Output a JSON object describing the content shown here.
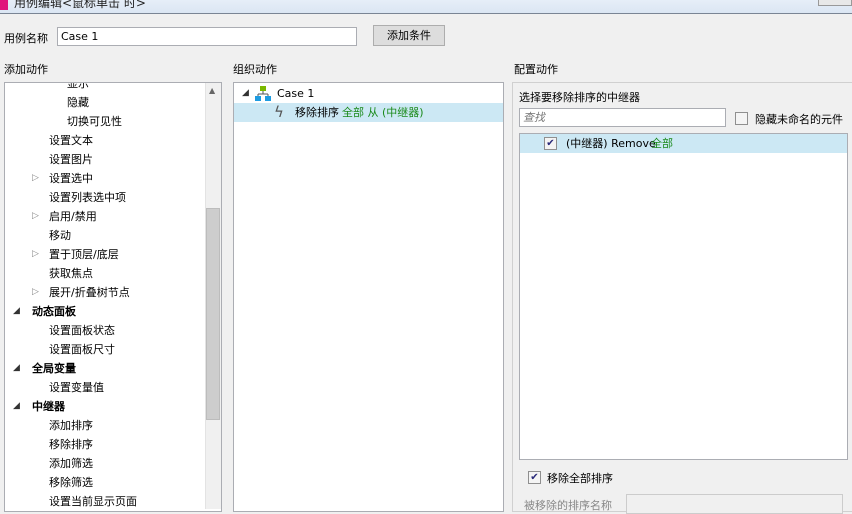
{
  "window": {
    "title": "用例编辑<鼠标单击 时>"
  },
  "case_name": {
    "label": "用例名称",
    "value": "Case 1"
  },
  "add_condition_label": "添加条件",
  "add_actions": {
    "heading": "添加动作",
    "items": [
      {
        "label": "显示",
        "level": 3
      },
      {
        "label": "隐藏",
        "level": 3
      },
      {
        "label": "切换可见性",
        "level": 3
      },
      {
        "label": "设置文本",
        "level": 2
      },
      {
        "label": "设置图片",
        "level": 2
      },
      {
        "label": "设置选中",
        "level": 2,
        "collapsed": true
      },
      {
        "label": "设置列表选中项",
        "level": 2
      },
      {
        "label": "启用/禁用",
        "level": 2,
        "collapsed": true
      },
      {
        "label": "移动",
        "level": 2
      },
      {
        "label": "置于顶层/底层",
        "level": 2,
        "collapsed": true
      },
      {
        "label": "获取焦点",
        "level": 2
      },
      {
        "label": "展开/折叠树节点",
        "level": 2,
        "collapsed": true
      },
      {
        "label": "动态面板",
        "level": 1,
        "expanded": true
      },
      {
        "label": "设置面板状态",
        "level": 2
      },
      {
        "label": "设置面板尺寸",
        "level": 2
      },
      {
        "label": "全局变量",
        "level": 1,
        "expanded": true
      },
      {
        "label": "设置变量值",
        "level": 2
      },
      {
        "label": "中继器",
        "level": 1,
        "expanded": true
      },
      {
        "label": "添加排序",
        "level": 2
      },
      {
        "label": "移除排序",
        "level": 2
      },
      {
        "label": "添加筛选",
        "level": 2
      },
      {
        "label": "移除筛选",
        "level": 2
      },
      {
        "label": "设置当前显示页面",
        "level": 2
      }
    ]
  },
  "organize": {
    "heading": "组织动作",
    "case": "Case 1",
    "action": {
      "name": "移除排序",
      "detail": "全部 从 (中继器)"
    }
  },
  "configure": {
    "heading": "配置动作",
    "subheading": "选择要移除排序的中继器",
    "search_placeholder": "查找",
    "hide_unnamed": "隐藏未命名的元件",
    "repeater_item": {
      "label": "(中继器) Remove",
      "tag": "全部",
      "checked": true
    },
    "remove_all": {
      "label": "移除全部排序",
      "checked": true
    },
    "sort_name_label": "被移除的排序名称",
    "sort_name_value": ""
  }
}
